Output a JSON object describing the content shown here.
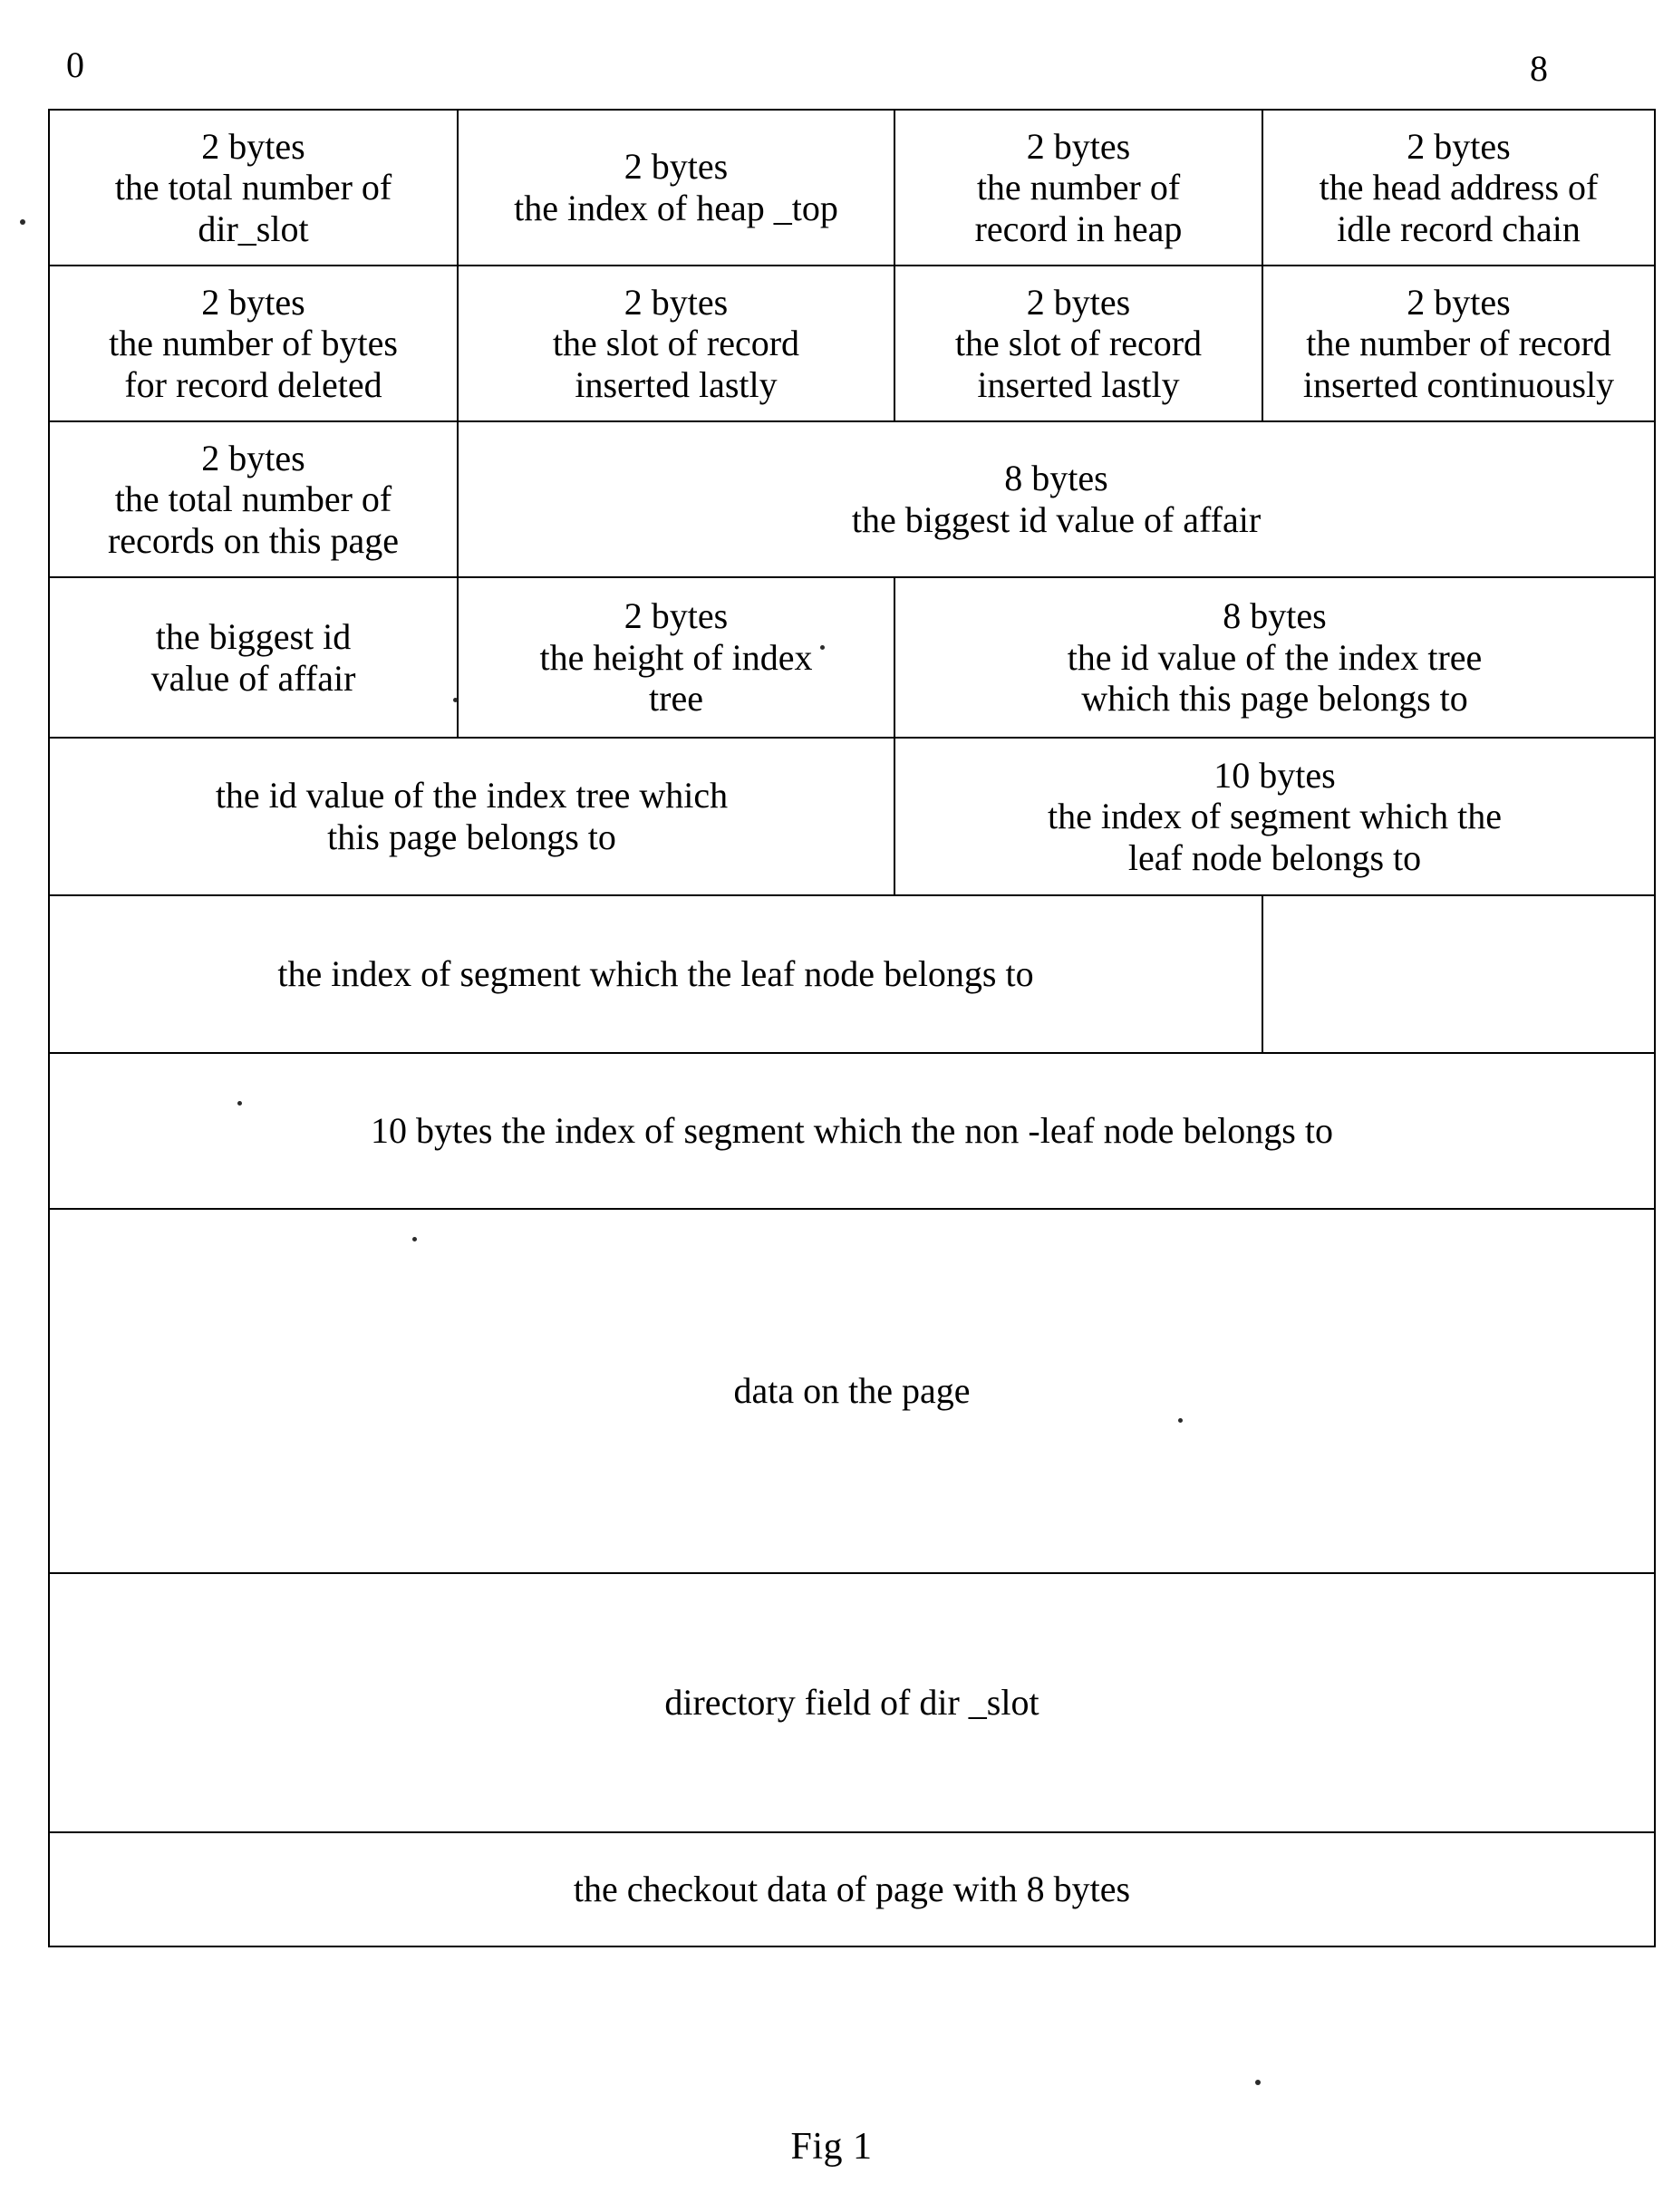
{
  "figure": {
    "caption": "Fig 1",
    "axis_labels": {
      "left": "0",
      "right": "8"
    }
  },
  "diagram": {
    "type": "page-layout-byte-map",
    "title_row_labels": [
      "0",
      "8"
    ],
    "rows": [
      {
        "id": "row-1",
        "cells": [
          {
            "size": "2 bytes",
            "desc_line1": "the total number of",
            "desc_line2": "dir_slot"
          },
          {
            "size": "2 bytes",
            "desc_line1": "the index of heap _top",
            "desc_line2": ""
          },
          {
            "size": "2 bytes",
            "desc_line1": "the number of",
            "desc_line2": "record in heap"
          },
          {
            "size": "2 bytes",
            "desc_line1": "the head address of",
            "desc_line2": "idle record chain"
          }
        ]
      },
      {
        "id": "row-2",
        "cells": [
          {
            "size": "2 bytes",
            "desc_line1": "the number of bytes",
            "desc_line2": "for record deleted"
          },
          {
            "size": "2 bytes",
            "desc_line1": "the slot of record",
            "desc_line2": "inserted lastly"
          },
          {
            "size": "2 bytes",
            "desc_line1": "the slot of record",
            "desc_line2": "inserted lastly"
          },
          {
            "size": "2 bytes",
            "desc_line1": "the number of record",
            "desc_line2": "inserted continuously"
          }
        ]
      },
      {
        "id": "row-3",
        "cells": [
          {
            "size": "2 bytes",
            "desc_line1": "the total number of",
            "desc_line2": "records on this page"
          },
          {
            "size": "8 bytes",
            "desc_line1": "the biggest id value of affair",
            "desc_line2": ""
          }
        ]
      },
      {
        "id": "row-4",
        "cells": [
          {
            "size": "",
            "desc_line1": "the biggest id",
            "desc_line2": "value of affair"
          },
          {
            "size": "2 bytes",
            "desc_line1": "the height of index",
            "desc_line2": "tree"
          },
          {
            "size": "8 bytes",
            "desc_line1": "the id value of the index tree",
            "desc_line2": "which this page belongs to"
          }
        ]
      },
      {
        "id": "row-5",
        "cells": [
          {
            "size": "",
            "desc_line1": "the id value of the index tree which",
            "desc_line2": "this page belongs to"
          },
          {
            "size": "10 bytes",
            "desc_line1": "the index of segment which the",
            "desc_line2": "leaf node belongs to"
          }
        ]
      },
      {
        "id": "row-6",
        "cells": [
          {
            "size": "",
            "desc_line1": "the index of segment which the leaf node belongs to",
            "desc_line2": ""
          },
          {
            "size": "",
            "desc_line1": "",
            "desc_line2": ""
          }
        ]
      },
      {
        "id": "row-7",
        "cells": [
          {
            "size": "",
            "desc_line1": "10 bytes   the index of segment which the non -leaf node belongs to",
            "desc_line2": ""
          }
        ]
      },
      {
        "id": "row-8",
        "cells": [
          {
            "size": "",
            "desc_line1": "data on the page",
            "desc_line2": ""
          }
        ]
      },
      {
        "id": "row-9",
        "cells": [
          {
            "size": "",
            "desc_line1": "directory field of dir _slot",
            "desc_line2": ""
          }
        ]
      },
      {
        "id": "row-10",
        "cells": [
          {
            "size": "",
            "desc_line1": "the checkout data of page with  8 bytes",
            "desc_line2": ""
          }
        ]
      }
    ]
  },
  "colors": {
    "ink": "#000000",
    "paper": "#ffffff"
  }
}
